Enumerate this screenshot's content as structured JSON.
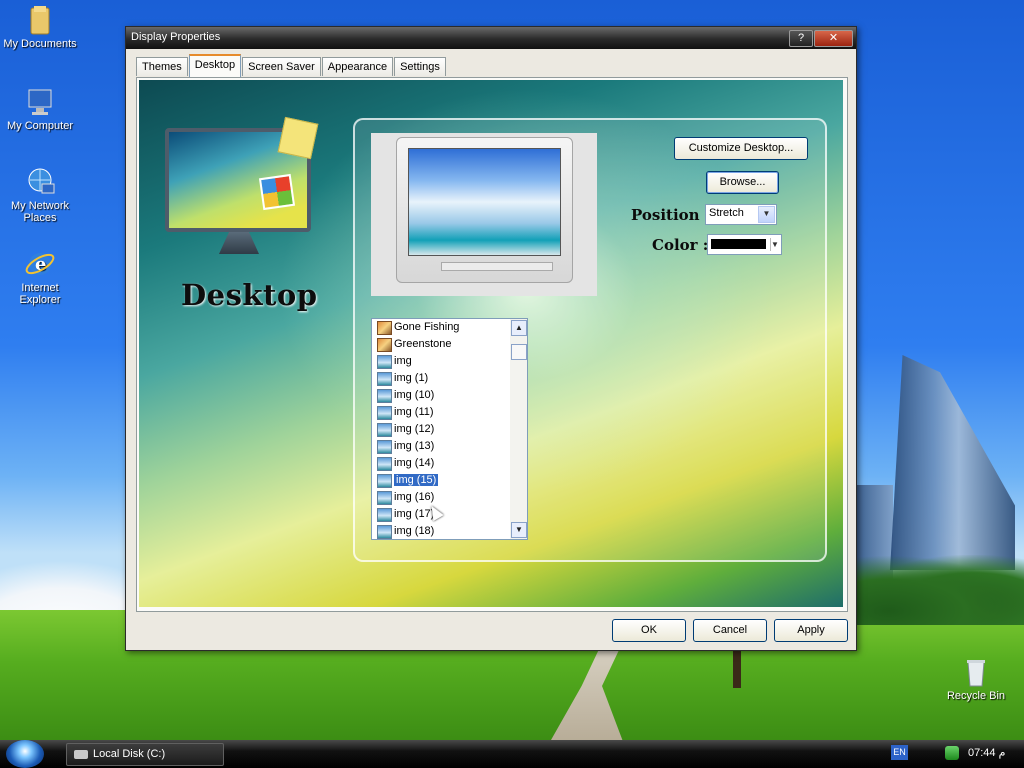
{
  "desktop": {
    "icons": [
      {
        "label": "My Documents"
      },
      {
        "label": "My Computer"
      },
      {
        "label": "My Network Places"
      },
      {
        "label": "Internet Explorer"
      },
      {
        "label": "Recycle Bin"
      }
    ]
  },
  "window": {
    "title": "Display Properties",
    "help_label": "?",
    "close_label": "✕",
    "tabs": [
      {
        "label": "Themes"
      },
      {
        "label": "Desktop",
        "active": true
      },
      {
        "label": "Screen Saver"
      },
      {
        "label": "Appearance"
      },
      {
        "label": "Settings"
      }
    ],
    "heading": "Desktop",
    "customize_label": "Customize Desktop...",
    "browse_label": "Browse...",
    "position_label": "Position :",
    "position_value": "Stretch",
    "color_label": "Color :",
    "color_value": "#000000",
    "backgrounds": [
      {
        "label": "Gone Fishing",
        "icon": "image-warm-icon"
      },
      {
        "label": "Greenstone",
        "icon": "image-warm-icon"
      },
      {
        "label": "img",
        "icon": "image-icon"
      },
      {
        "label": "img (1)",
        "icon": "image-icon"
      },
      {
        "label": "img (10)",
        "icon": "image-icon"
      },
      {
        "label": "img (11)",
        "icon": "image-icon"
      },
      {
        "label": "img (12)",
        "icon": "image-icon"
      },
      {
        "label": "img (13)",
        "icon": "image-icon"
      },
      {
        "label": "img (14)",
        "icon": "image-icon"
      },
      {
        "label": "img (15)",
        "icon": "image-icon",
        "selected": true
      },
      {
        "label": "img (16)",
        "icon": "image-icon"
      },
      {
        "label": "img (17)",
        "icon": "image-icon"
      },
      {
        "label": "img (18)",
        "icon": "image-icon"
      }
    ],
    "ok_label": "OK",
    "cancel_label": "Cancel",
    "apply_label": "Apply"
  },
  "taskbar": {
    "task_label": "Local Disk (C:)",
    "language": "EN",
    "clock": "07:44 م"
  }
}
